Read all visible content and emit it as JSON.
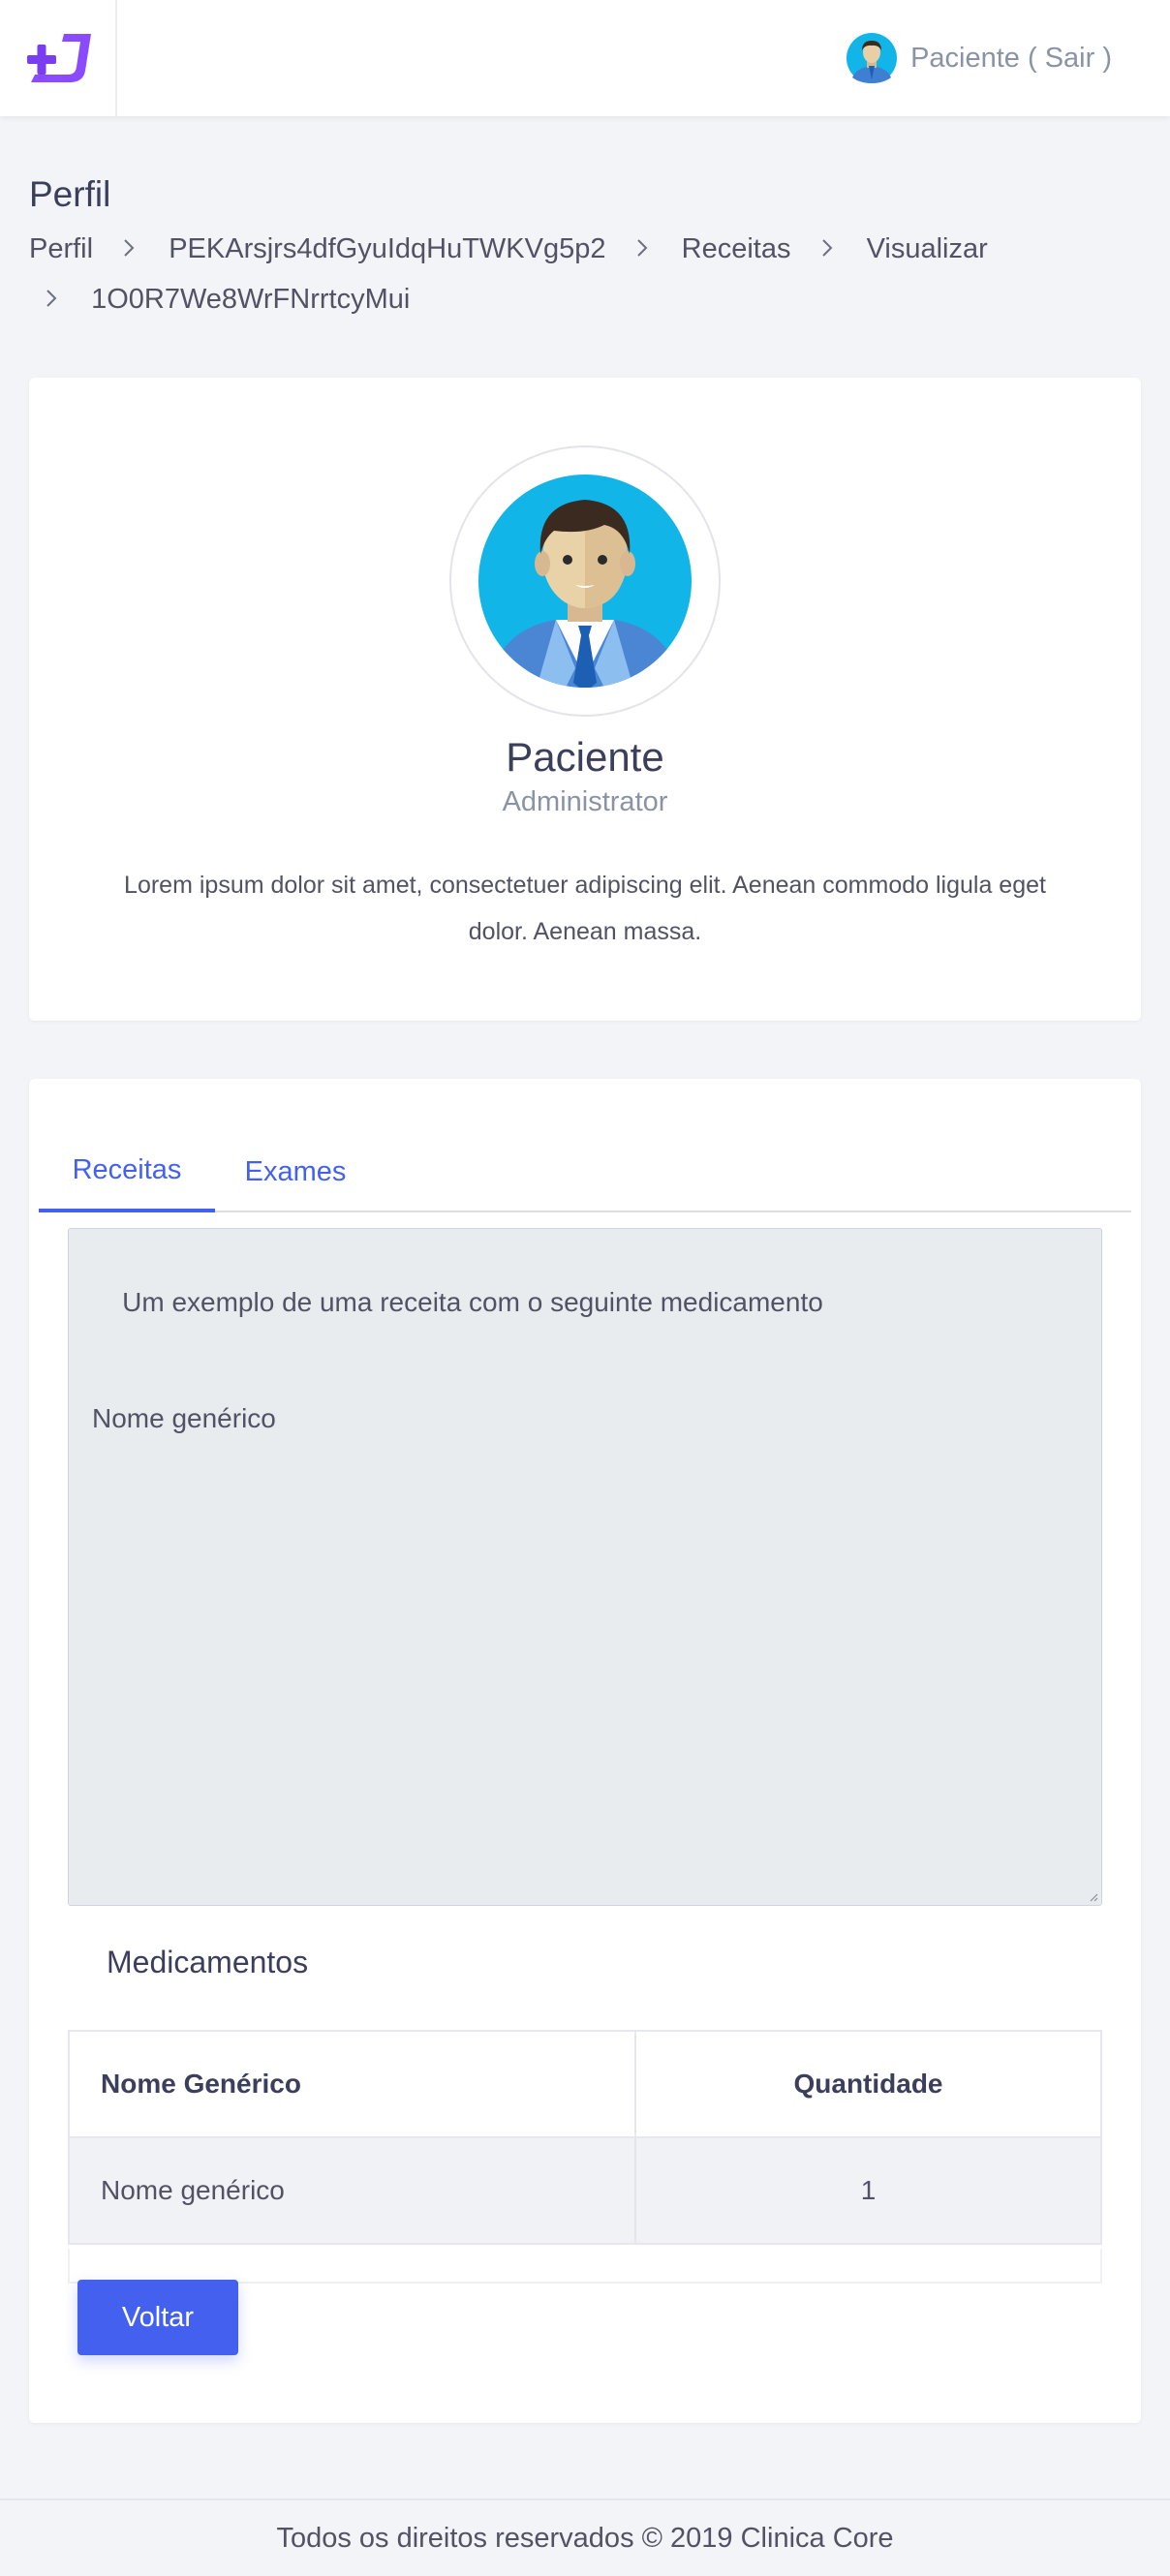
{
  "header": {
    "logo_icon": "plus-j-logo-icon",
    "user_label": "Paciente ( Sair )"
  },
  "page": {
    "title": "Perfil",
    "breadcrumb": [
      "Perfil",
      "PEKArsjrs4dfGyuIdqHuTWKVg5p2",
      "Receitas",
      "Visualizar",
      "1O0R7We8WrFNrrtcyMui"
    ]
  },
  "profile": {
    "name": "Paciente",
    "role": "Administrator",
    "bio": "Lorem ipsum dolor sit amet, consectetuer adipiscing elit. Aenean commodo ligula eget dolor. Aenean massa."
  },
  "tabs": [
    {
      "label": "Receitas",
      "active": true
    },
    {
      "label": "Exames",
      "active": false
    }
  ],
  "recipe": {
    "text": "Um exemplo de uma receita com o seguinte medicamento\n\n\nNome genérico"
  },
  "medications": {
    "title": "Medicamentos",
    "columns": [
      "Nome Genérico",
      "Quantidade"
    ],
    "rows": [
      {
        "name": "Nome genérico",
        "quantity": "1"
      }
    ]
  },
  "actions": {
    "back_label": "Voltar"
  },
  "footer": {
    "text": "Todos os direitos reservados © 2019 Clinica Core"
  },
  "colors": {
    "primary": "#4361ee",
    "background": "#f3f4f7",
    "logo": "#8a4bff"
  }
}
